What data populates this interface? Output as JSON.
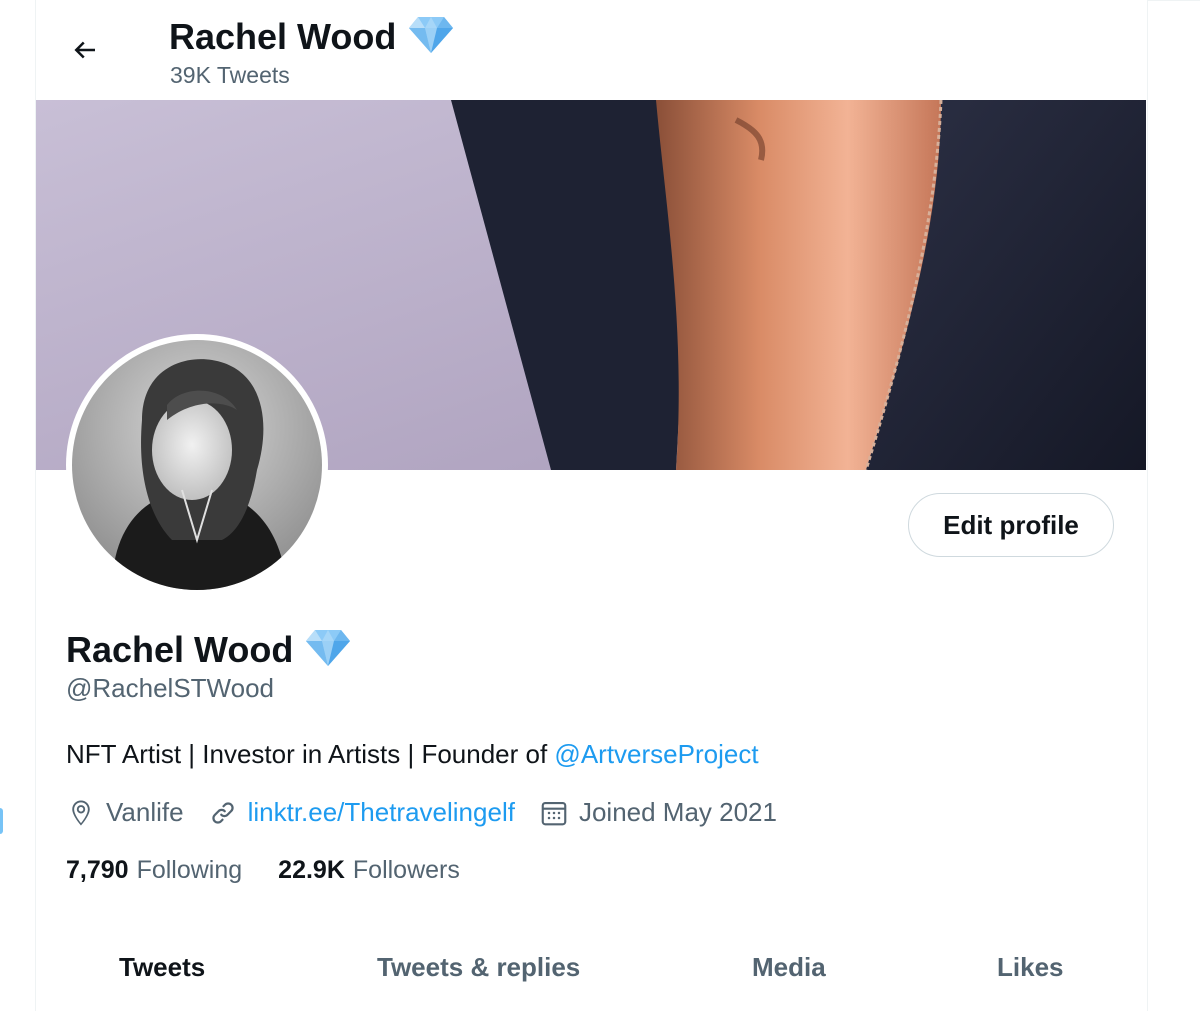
{
  "header": {
    "name": "Rachel Wood",
    "tweet_count": "39K Tweets",
    "verified_badge_icon": "diamond-icon"
  },
  "banner": {
    "description_colors": {
      "left_panel": "#b9aec9",
      "dark_panel": "#1f2333",
      "skin": "#d98a64",
      "fabric": "#262a3d"
    }
  },
  "profile": {
    "name": "Rachel Wood",
    "handle": "@RachelSTWood",
    "bio_text": "NFT Artist | Investor in Artists | Founder of ",
    "bio_mention": "@ArtverseProject",
    "location": "Vanlife",
    "website": "linktr.ee/Thetravelingelf",
    "joined": "Joined May 2021",
    "edit_button_label": "Edit profile"
  },
  "stats": {
    "following_count": "7,790",
    "following_label": "Following",
    "followers_count": "22.9K",
    "followers_label": "Followers"
  },
  "tabs": [
    {
      "label": "Tweets",
      "active": true
    },
    {
      "label": "Tweets & replies",
      "active": false
    },
    {
      "label": "Media",
      "active": false
    },
    {
      "label": "Likes",
      "active": false
    }
  ],
  "colors": {
    "accent": "#1d9bf0",
    "text_primary": "#0f1419",
    "text_secondary": "#536471",
    "border": "#cfd9de",
    "diamond": "#5fb0f0"
  },
  "icons": {
    "back": "arrow-left-icon",
    "location": "location-pin-icon",
    "link": "link-icon",
    "calendar": "calendar-icon",
    "badge": "diamond-icon"
  }
}
